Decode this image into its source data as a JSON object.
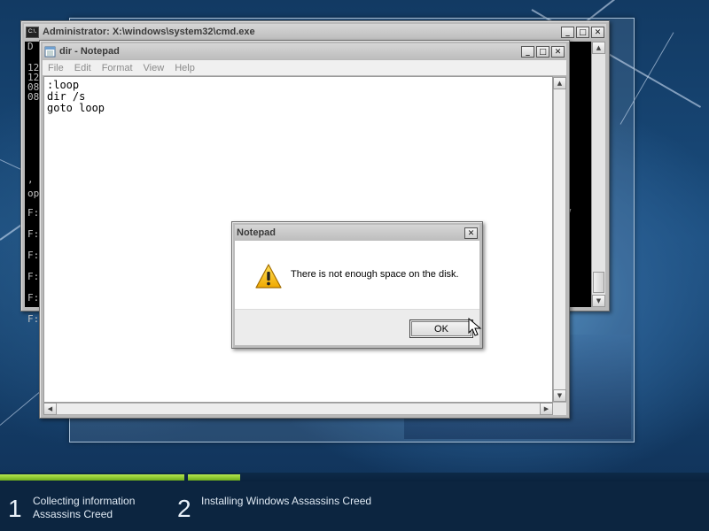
{
  "cmd_window": {
    "title": "Administrator: X:\\windows\\system32\\cmd.exe",
    "icon_text": "C:\\.",
    "console_lines": [
      "D",
      "12",
      "12",
      "08",
      "08",
      ",",
      "op",
      "F:",
      "F:",
      "F:",
      "F:",
      "F:",
      "F:"
    ],
    "right_char": "V"
  },
  "notepad_window": {
    "title": "dir - Notepad",
    "menu": [
      "File",
      "Edit",
      "Format",
      "View",
      "Help"
    ],
    "content": ":loop\ndir /s\ngoto loop"
  },
  "message_box": {
    "title": "Notepad",
    "message": "There is not enough space on the disk.",
    "ok_label": "OK",
    "icon": "warning-icon"
  },
  "setup_progress": {
    "steps": [
      {
        "number": "1",
        "line1": "Collecting information",
        "line2": "Assassins Creed"
      },
      {
        "number": "2",
        "line1": "Installing Windows Assassins Creed",
        "line2": ""
      }
    ],
    "step1_fill": 1.0,
    "step2_fill": 0.1,
    "bar_color": "#8fcc2a"
  },
  "window_controls": {
    "minimize": "_",
    "maximize": "□",
    "close": "✕"
  }
}
